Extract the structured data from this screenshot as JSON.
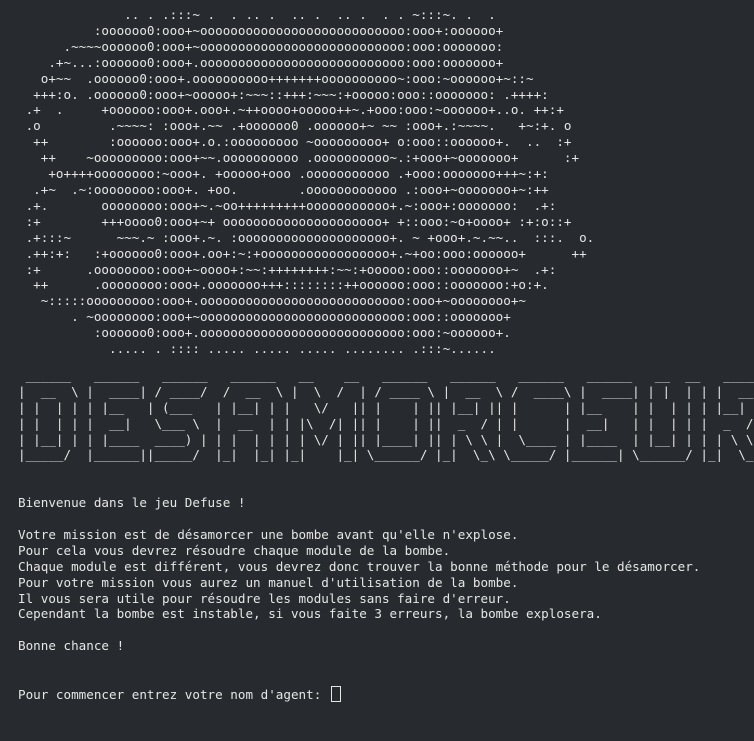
{
  "terminal": {
    "bomb_art": [
      "              .. . .:::~ .  . .. .  .. .  .. .  . . ~:::~. .  .",
      "          :oooooo0:ooo+~ooooooooooooooooooooooooooo:ooo+:oooooo+",
      "      .~~~~oooooo0:ooo+~ooooooooooooooooooooooooooo:ooo:ooooooo:",
      "    .+~...:oooooo0:ooo+.ooooooooooooooooooooooooooo:ooo:ooooooo+",
      "   o+~~  .oooooo0:ooo+.oooooooooo+++++++oooooooooo~:ooo:~oooooo+~::~",
      "  +++:o. .oooooo0:ooo+~ooooo+:~~~::+++:~~~:+ooooo:ooo::ooooooo: .++++:",
      " .+  .     +oooooo:ooo+.ooo+.~++oooo+ooooo++~.+ooo:ooo:~oooooo+..o. ++:+",
      " .o         .~~~~: :ooo+.~~ .+oooooo0 .oooooo+~ ~~ :ooo+.:~~~~.   +~:+. o",
      "  ++        :oooooo:ooo+.o.:ooooooooo ~ooooooooo+ o:ooo::oooooo+.  ..  :+",
      "   ++    ~ooooooooo:ooo+~~.oooooooooo .oooooooooo~.:+ooo+~ooooooo+      :+",
      "    +o++++oooooooo:~ooo+. +ooooo+ooo .ooooooooooo .+ooo:ooooooo+++~:+:",
      "  .+~  .~:oooooooo:ooo+. +oo.        .oooooooooooo .:ooo+~ooooooo+~:++",
      " .+.       oooooooo:ooo+~.~oo+++++++++ooooooooooo+.~:ooo+:ooooooo:  .+:",
      " :+        +++oooo0:ooo+~+ ooooooooooooooooooooo+ +::ooo:~o+oooo+ :+:o::+",
      " .+:::~      ~~~.~ :ooo+.~. :oooooooooooooooooooo+. ~ +ooo+.~.~~..  :::.  o.",
      " .++:+:   :+oooooo0:ooo+.oo+:~:+ooooooooooooooooo+.~+oo:ooo:oooooo+      ++",
      " :+      .oooooooo:ooo+~oooo+:~~:++++++++:~~:+ooooo:ooo::ooooooo+~  .+:",
      "  ++      .oooooooo:ooo+.ooooooo+++::::::::++oooooo:ooo::ooooooo:+o:+.",
      "   ~:::::ooooooooo:ooo+.ooooooooooooooooooooooooooo:ooo+~oooooooo+~",
      "       . ~oooooooo:ooo+~ooooooooooooooooooooooooooo:ooo::ooooooo+",
      "          :oooooo0:ooo+.ooooooooooooooooooooooooooo:ooo:~oooooo+.",
      "            ..... . :::: ..... ..... ..... ........ .:::~......"
    ],
    "title_banner": [
      " ______   ______   ______   ______   __    __   ______   ______   ______   ______   __  __   ______   ",
      "|  __  \\ |  ____| / ____/  /  __  \\ |  \\  /  | / ____ \\ |  __  \\ /  ____\\ |  ____| | |  | | |  __  \\  ",
      "| |  | | | |__   | (___   | |__| | |   \\/   || |    | || |__| || |      | |__    | |  | | | |__| |  ",
      "| |  | | |  __|   \\___ \\  |  __  | | |\\  /| || |    | ||  _  / | |      |  __|   | |  | | |  _  /   ",
      "| |__| | | |____  ____) | | |  | | | | \\/ | || |____| || | \\ \\ |  \\____ | |____  | |__| | | | \\ \\   ",
      "|_____/  |______||_____/  |_|  |_| |_|    |_| \\______/ |_|  \\_\\ \\_____/ |______| \\______/ |_|  \\_\\  "
    ],
    "welcome_line": "Bienvenue dans le jeu Defuse !",
    "mission_lines": [
      "Votre mission est de désamorcer une bombe avant qu'elle n'explose.",
      "Pour cela vous devrez résoudre chaque module de la bombe.",
      "Chaque module est différent, vous devrez donc trouver la bonne méthode pour le désamorcer.",
      "Pour votre mission vous aurez un manuel d'utilisation de la bombe.",
      "Il vous sera utile pour résoudre les modules sans faire d'erreur.",
      "Cependant la bombe est instable, si vous faite 3 erreurs, la bombe explosera."
    ],
    "good_luck_line": "Bonne chance !",
    "prompt_text": "Pour commencer entrez votre nom d'agent: ",
    "input_value": "",
    "colors": {
      "background": "#272a2e",
      "foreground": "#e6e6e6"
    }
  }
}
